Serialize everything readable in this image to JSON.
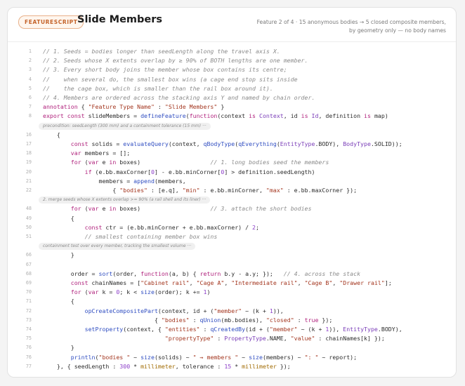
{
  "header": {
    "badge": "FEATURESCRIPT",
    "title": "Slide Members",
    "summary_line1": "Feature 2 of 4 · 15 anonymous bodies → 5 closed composite members,",
    "summary_line2": "by geometry only — no body names"
  },
  "code": {
    "lines": [
      {
        "n": "1",
        "html": "<span class=\"c\">// 1. Seeds = bodies longer than seedLength along the travel axis X.</span>"
      },
      {
        "n": "2",
        "html": "<span class=\"c\">// 2. Seeds whose X extents overlap by ≥ 90% of BOTH lengths are one member.</span>"
      },
      {
        "n": "3",
        "html": "<span class=\"c\">// 3. Every short body joins the member whose box contains its centre;</span>"
      },
      {
        "n": "4",
        "html": "<span class=\"c\">//    when several do, the smallest box wins (a cage end stop sits inside</span>"
      },
      {
        "n": "5",
        "html": "<span class=\"c\">//    the cage box, which is smaller than the rail box around it).</span>"
      },
      {
        "n": "6",
        "html": "<span class=\"c\">// 4. Members are ordered across the stacking axis Y and named by chain order.</span>"
      },
      {
        "n": "7",
        "html": "<span class=\"k\">annotation</span> { <span class=\"s\">\"Feature Type Name\"</span> : <span class=\"s\">\"Slide Members\"</span> }"
      },
      {
        "n": "8",
        "html": "<span class=\"k\">export const</span> slideMembers = <span class=\"f\">defineFeature</span>(<span class=\"k\">function</span>(context <span class=\"k\">is</span> <span class=\"t\">Context</span>, id <span class=\"k\">is</span> <span class=\"t\">Id</span>, definition <span class=\"k\">is</span> map)"
      },
      {
        "fold": "precondition: seedLength (300 mm) and a containment tolerance (15 mm)  ···"
      },
      {
        "n": "16",
        "html": "    {"
      },
      {
        "n": "17",
        "html": "        <span class=\"k\">const</span> solids = <span class=\"f\">evaluateQuery</span>(context, <span class=\"f\">qBodyType</span>(<span class=\"f\">qEverything</span>(<span class=\"t\">EntityType</span>.BODY), <span class=\"t\">BodyType</span>.SOLID));"
      },
      {
        "n": "18",
        "html": "        <span class=\"k\">var</span> members = [];"
      },
      {
        "n": "19",
        "html": "        <span class=\"k\">for</span> (<span class=\"k\">var</span> e <span class=\"k\">in</span> boxes)                    <span class=\"c\">// 1. long bodies seed the members</span>"
      },
      {
        "n": "20",
        "html": "            <span class=\"k\">if</span> (e.bb.maxCorner[<span class=\"n\">0</span>] - e.bb.minCorner[<span class=\"n\">0</span>] > definition.seedLength)"
      },
      {
        "n": "21",
        "html": "                members = <span class=\"f\">append</span>(members,"
      },
      {
        "n": "22",
        "html": "                    { <span class=\"s\">\"bodies\"</span> : [e.q], <span class=\"s\">\"min\"</span> : e.bb.minCorner, <span class=\"s\">\"max\"</span> : e.bb.maxCorner });"
      },
      {
        "fold": "2. merge seeds whose X extents overlap >= 90% (a rail shell and its liner)  ···"
      },
      {
        "n": "48",
        "html": "        <span class=\"k\">for</span> (<span class=\"k\">var</span> e <span class=\"k\">in</span> boxes)                    <span class=\"c\">// 3. attach the short bodies</span>"
      },
      {
        "n": "49",
        "html": "        {"
      },
      {
        "n": "50",
        "html": "            <span class=\"k\">const</span> ctr = (e.bb.minCorner + e.bb.maxCorner) / <span class=\"n\">2</span>;"
      },
      {
        "n": "51",
        "html": "            <span class=\"c\">// smallest containing member box wins</span>"
      },
      {
        "fold": "containment test over every member, tracking the smallest volume  ···"
      },
      {
        "n": "66",
        "html": "        }"
      },
      {
        "n": "67",
        "html": ""
      },
      {
        "n": "68",
        "html": "        order = <span class=\"f\">sort</span>(order, <span class=\"k\">function</span>(a, b) { <span class=\"k\">return</span> b.y - a.y; });   <span class=\"c\">// 4. across the stack</span>"
      },
      {
        "n": "69",
        "html": "        <span class=\"k\">const</span> chainNames = [<span class=\"s\">\"Cabinet rail\"</span>, <span class=\"s\">\"Cage A\"</span>, <span class=\"s\">\"Intermediate rail\"</span>, <span class=\"s\">\"Cage B\"</span>, <span class=\"s\">\"Drawer rail\"</span>];"
      },
      {
        "n": "70",
        "html": "        <span class=\"k\">for</span> (<span class=\"k\">var</span> k = <span class=\"n\">0</span>; k < <span class=\"f\">size</span>(order); k += <span class=\"n\">1</span>)"
      },
      {
        "n": "71",
        "html": "        {"
      },
      {
        "n": "72",
        "html": "            <span class=\"f\">opCreateCompositePart</span>(context, id + (<span class=\"s\">\"member\"</span> ~ (k + <span class=\"n\">1</span>)),"
      },
      {
        "n": "73",
        "html": "                                { <span class=\"s\">\"bodies\"</span> : <span class=\"f\">qUnion</span>(mb.bodies), <span class=\"s\">\"closed\"</span> : <span class=\"k\">true</span> });"
      },
      {
        "n": "74",
        "html": "            <span class=\"f\">setProperty</span>(context, { <span class=\"s\">\"entities\"</span> : <span class=\"f\">qCreatedBy</span>(id + (<span class=\"s\">\"member\"</span> ~ (k + <span class=\"n\">1</span>)), <span class=\"t\">EntityType</span>.BODY),"
      },
      {
        "n": "75",
        "html": "                                   <span class=\"s\">\"propertyType\"</span> : <span class=\"t\">PropertyType</span>.NAME, <span class=\"s\">\"value\"</span> : chainNames[k] });"
      },
      {
        "n": "76",
        "html": "        }"
      },
      {
        "n": "76",
        "html": "        <span class=\"f\">println</span>(<span class=\"s\">\"bodies \"</span> ~ <span class=\"f\">size</span>(solids) ~ <span class=\"s\">\" → members \"</span> ~ <span class=\"f\">size</span>(members) ~ <span class=\"s\">\": \"</span> ~ report);"
      },
      {
        "n": "77",
        "html": "    }, { seedLength : <span class=\"n\">300</span> * <span class=\"a\">millimeter</span>, tolerance : <span class=\"n\">15</span> * <span class=\"a\">millimeter</span> });"
      }
    ]
  }
}
